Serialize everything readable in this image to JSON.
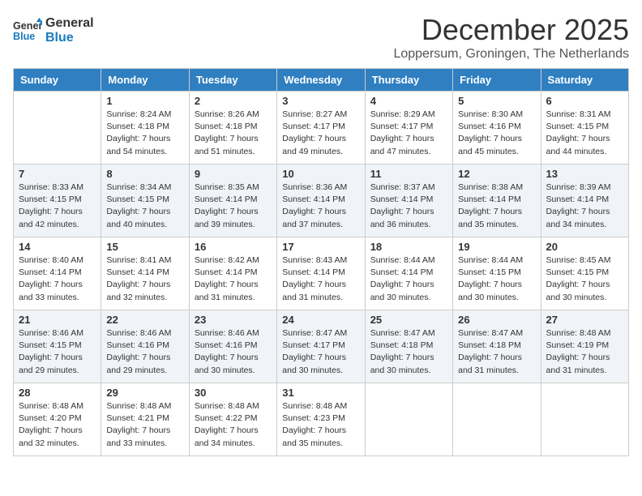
{
  "logo": {
    "line1": "General",
    "line2": "Blue"
  },
  "title": "December 2025",
  "location": "Loppersum, Groningen, The Netherlands",
  "weekdays": [
    "Sunday",
    "Monday",
    "Tuesday",
    "Wednesday",
    "Thursday",
    "Friday",
    "Saturday"
  ],
  "weeks": [
    [
      {
        "day": "",
        "sunrise": "",
        "sunset": "",
        "daylight": ""
      },
      {
        "day": "1",
        "sunrise": "Sunrise: 8:24 AM",
        "sunset": "Sunset: 4:18 PM",
        "daylight": "Daylight: 7 hours and 54 minutes."
      },
      {
        "day": "2",
        "sunrise": "Sunrise: 8:26 AM",
        "sunset": "Sunset: 4:18 PM",
        "daylight": "Daylight: 7 hours and 51 minutes."
      },
      {
        "day": "3",
        "sunrise": "Sunrise: 8:27 AM",
        "sunset": "Sunset: 4:17 PM",
        "daylight": "Daylight: 7 hours and 49 minutes."
      },
      {
        "day": "4",
        "sunrise": "Sunrise: 8:29 AM",
        "sunset": "Sunset: 4:17 PM",
        "daylight": "Daylight: 7 hours and 47 minutes."
      },
      {
        "day": "5",
        "sunrise": "Sunrise: 8:30 AM",
        "sunset": "Sunset: 4:16 PM",
        "daylight": "Daylight: 7 hours and 45 minutes."
      },
      {
        "day": "6",
        "sunrise": "Sunrise: 8:31 AM",
        "sunset": "Sunset: 4:15 PM",
        "daylight": "Daylight: 7 hours and 44 minutes."
      }
    ],
    [
      {
        "day": "7",
        "sunrise": "Sunrise: 8:33 AM",
        "sunset": "Sunset: 4:15 PM",
        "daylight": "Daylight: 7 hours and 42 minutes."
      },
      {
        "day": "8",
        "sunrise": "Sunrise: 8:34 AM",
        "sunset": "Sunset: 4:15 PM",
        "daylight": "Daylight: 7 hours and 40 minutes."
      },
      {
        "day": "9",
        "sunrise": "Sunrise: 8:35 AM",
        "sunset": "Sunset: 4:14 PM",
        "daylight": "Daylight: 7 hours and 39 minutes."
      },
      {
        "day": "10",
        "sunrise": "Sunrise: 8:36 AM",
        "sunset": "Sunset: 4:14 PM",
        "daylight": "Daylight: 7 hours and 37 minutes."
      },
      {
        "day": "11",
        "sunrise": "Sunrise: 8:37 AM",
        "sunset": "Sunset: 4:14 PM",
        "daylight": "Daylight: 7 hours and 36 minutes."
      },
      {
        "day": "12",
        "sunrise": "Sunrise: 8:38 AM",
        "sunset": "Sunset: 4:14 PM",
        "daylight": "Daylight: 7 hours and 35 minutes."
      },
      {
        "day": "13",
        "sunrise": "Sunrise: 8:39 AM",
        "sunset": "Sunset: 4:14 PM",
        "daylight": "Daylight: 7 hours and 34 minutes."
      }
    ],
    [
      {
        "day": "14",
        "sunrise": "Sunrise: 8:40 AM",
        "sunset": "Sunset: 4:14 PM",
        "daylight": "Daylight: 7 hours and 33 minutes."
      },
      {
        "day": "15",
        "sunrise": "Sunrise: 8:41 AM",
        "sunset": "Sunset: 4:14 PM",
        "daylight": "Daylight: 7 hours and 32 minutes."
      },
      {
        "day": "16",
        "sunrise": "Sunrise: 8:42 AM",
        "sunset": "Sunset: 4:14 PM",
        "daylight": "Daylight: 7 hours and 31 minutes."
      },
      {
        "day": "17",
        "sunrise": "Sunrise: 8:43 AM",
        "sunset": "Sunset: 4:14 PM",
        "daylight": "Daylight: 7 hours and 31 minutes."
      },
      {
        "day": "18",
        "sunrise": "Sunrise: 8:44 AM",
        "sunset": "Sunset: 4:14 PM",
        "daylight": "Daylight: 7 hours and 30 minutes."
      },
      {
        "day": "19",
        "sunrise": "Sunrise: 8:44 AM",
        "sunset": "Sunset: 4:15 PM",
        "daylight": "Daylight: 7 hours and 30 minutes."
      },
      {
        "day": "20",
        "sunrise": "Sunrise: 8:45 AM",
        "sunset": "Sunset: 4:15 PM",
        "daylight": "Daylight: 7 hours and 30 minutes."
      }
    ],
    [
      {
        "day": "21",
        "sunrise": "Sunrise: 8:46 AM",
        "sunset": "Sunset: 4:15 PM",
        "daylight": "Daylight: 7 hours and 29 minutes."
      },
      {
        "day": "22",
        "sunrise": "Sunrise: 8:46 AM",
        "sunset": "Sunset: 4:16 PM",
        "daylight": "Daylight: 7 hours and 29 minutes."
      },
      {
        "day": "23",
        "sunrise": "Sunrise: 8:46 AM",
        "sunset": "Sunset: 4:16 PM",
        "daylight": "Daylight: 7 hours and 30 minutes."
      },
      {
        "day": "24",
        "sunrise": "Sunrise: 8:47 AM",
        "sunset": "Sunset: 4:17 PM",
        "daylight": "Daylight: 7 hours and 30 minutes."
      },
      {
        "day": "25",
        "sunrise": "Sunrise: 8:47 AM",
        "sunset": "Sunset: 4:18 PM",
        "daylight": "Daylight: 7 hours and 30 minutes."
      },
      {
        "day": "26",
        "sunrise": "Sunrise: 8:47 AM",
        "sunset": "Sunset: 4:18 PM",
        "daylight": "Daylight: 7 hours and 31 minutes."
      },
      {
        "day": "27",
        "sunrise": "Sunrise: 8:48 AM",
        "sunset": "Sunset: 4:19 PM",
        "daylight": "Daylight: 7 hours and 31 minutes."
      }
    ],
    [
      {
        "day": "28",
        "sunrise": "Sunrise: 8:48 AM",
        "sunset": "Sunset: 4:20 PM",
        "daylight": "Daylight: 7 hours and 32 minutes."
      },
      {
        "day": "29",
        "sunrise": "Sunrise: 8:48 AM",
        "sunset": "Sunset: 4:21 PM",
        "daylight": "Daylight: 7 hours and 33 minutes."
      },
      {
        "day": "30",
        "sunrise": "Sunrise: 8:48 AM",
        "sunset": "Sunset: 4:22 PM",
        "daylight": "Daylight: 7 hours and 34 minutes."
      },
      {
        "day": "31",
        "sunrise": "Sunrise: 8:48 AM",
        "sunset": "Sunset: 4:23 PM",
        "daylight": "Daylight: 7 hours and 35 minutes."
      },
      {
        "day": "",
        "sunrise": "",
        "sunset": "",
        "daylight": ""
      },
      {
        "day": "",
        "sunrise": "",
        "sunset": "",
        "daylight": ""
      },
      {
        "day": "",
        "sunrise": "",
        "sunset": "",
        "daylight": ""
      }
    ]
  ]
}
